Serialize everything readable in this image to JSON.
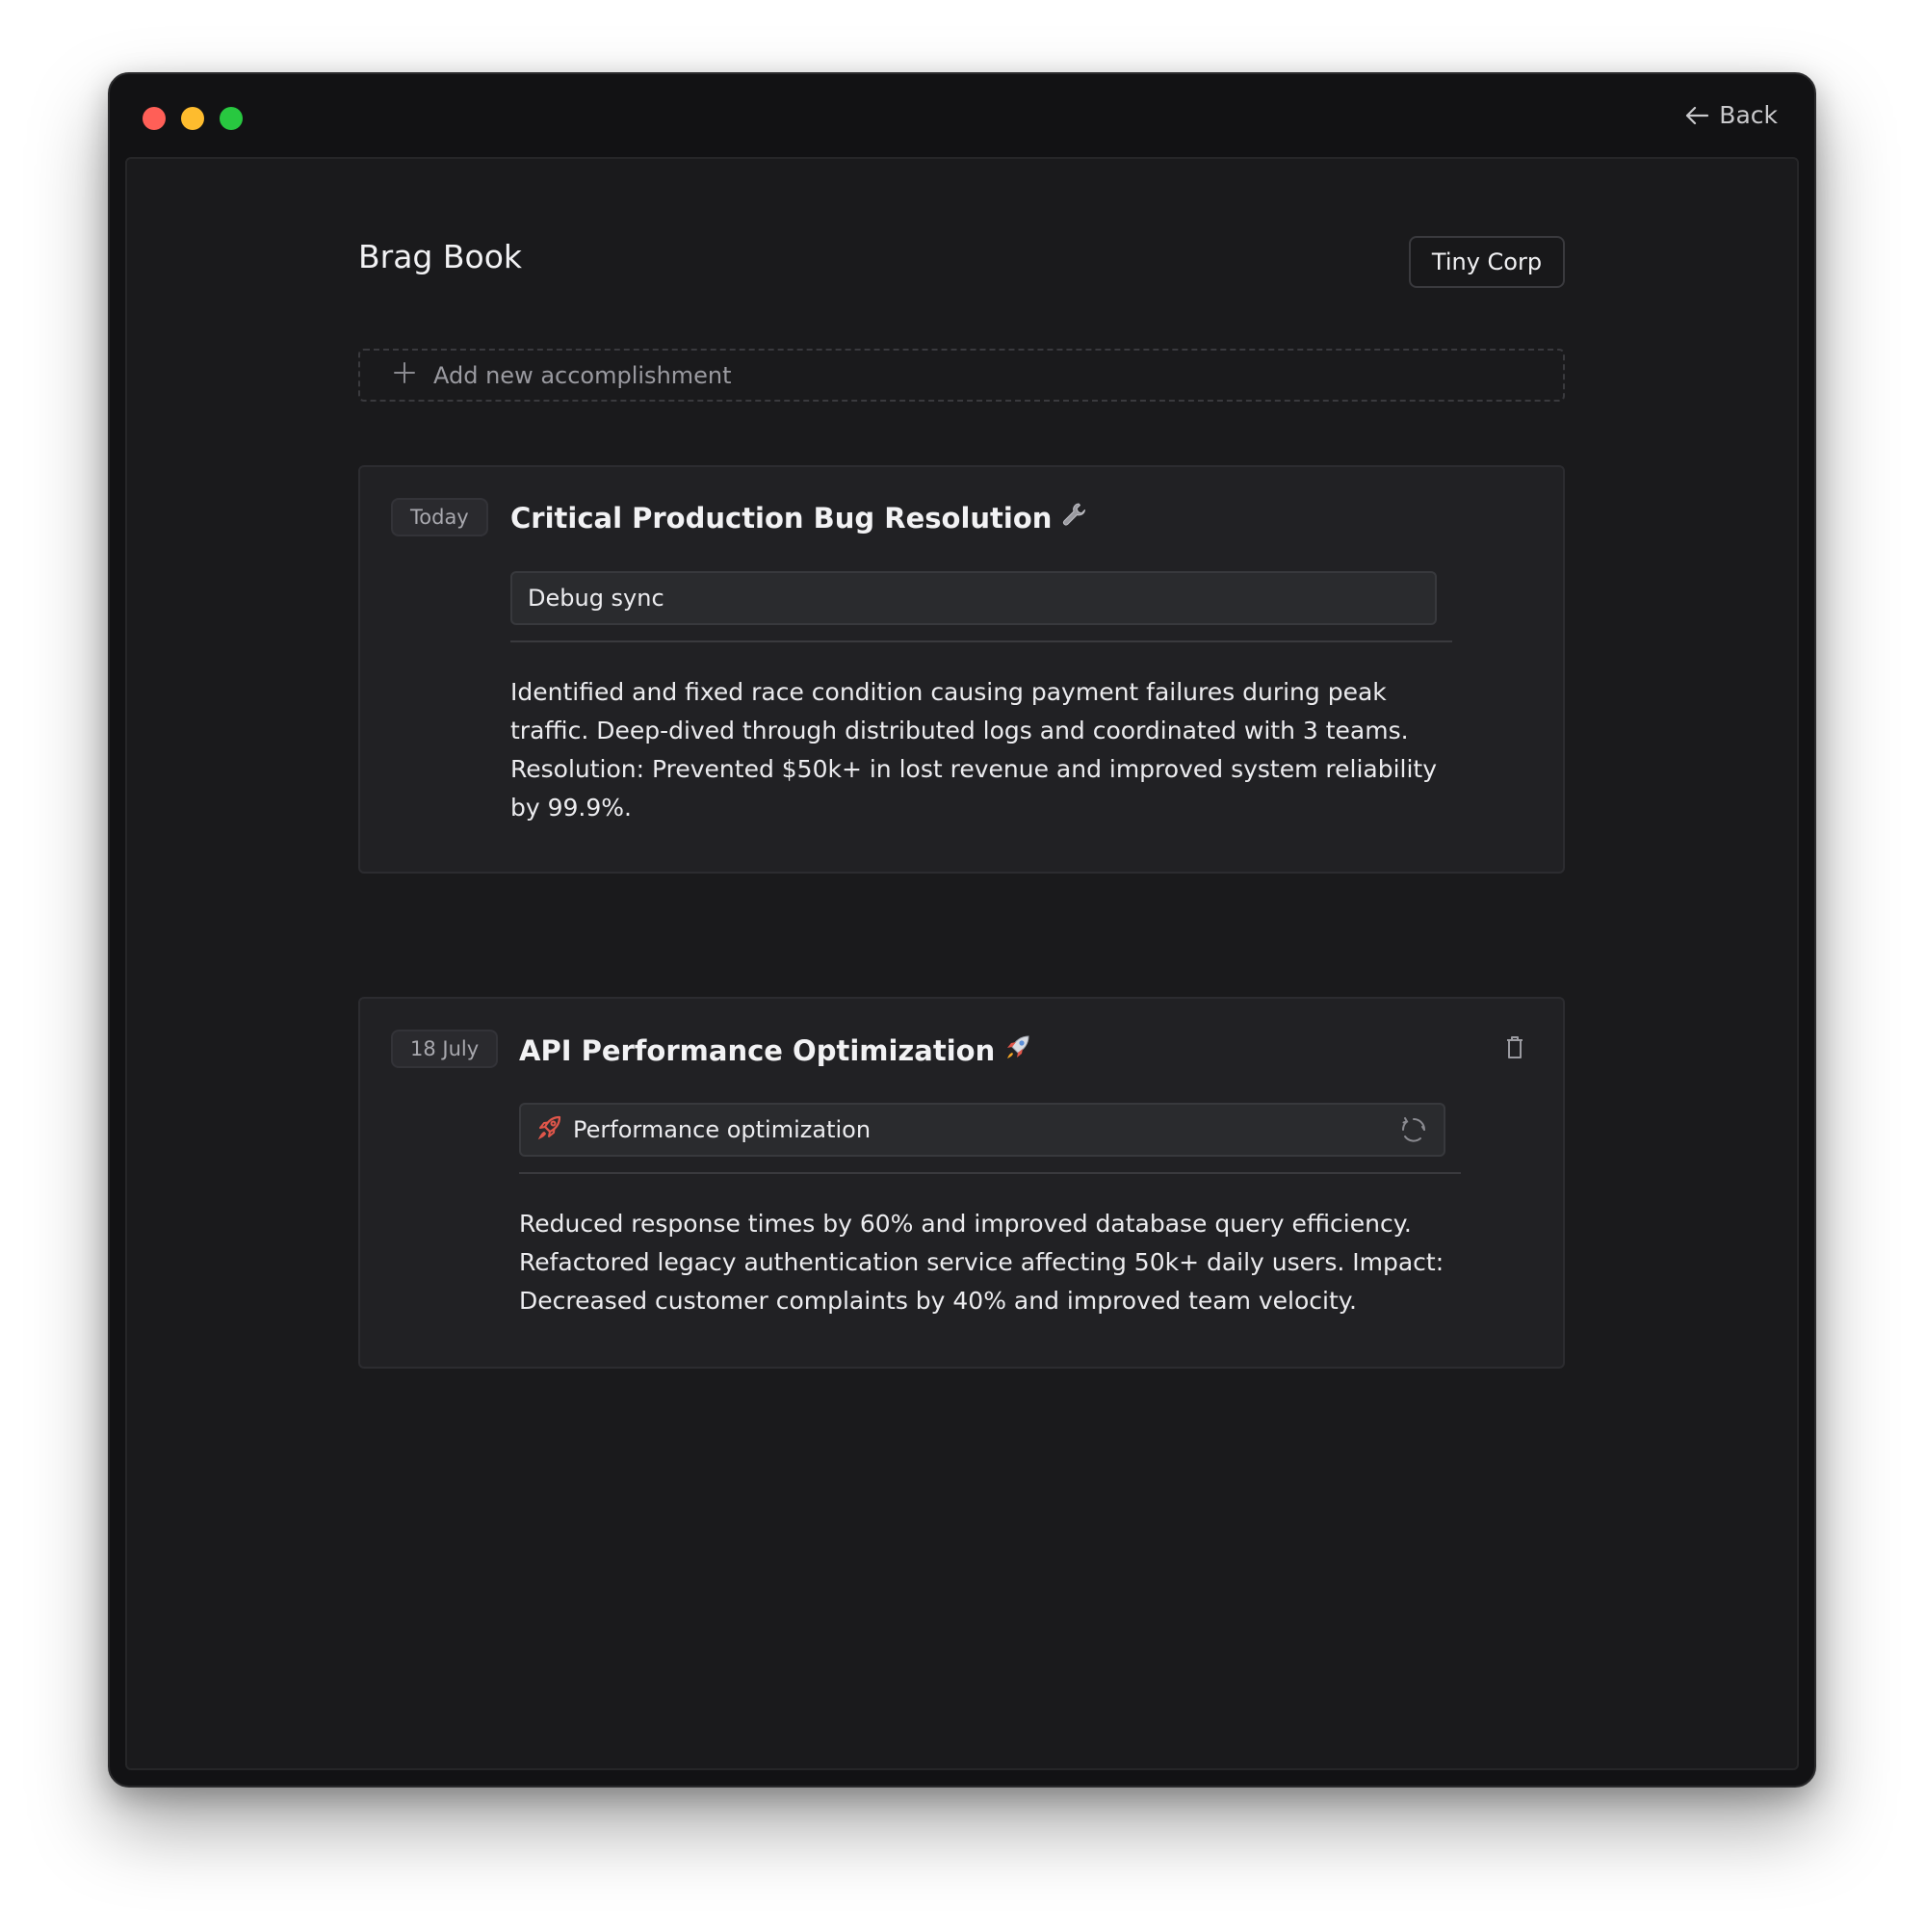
{
  "window": {
    "back_label": "Back"
  },
  "header": {
    "title": "Brag Book",
    "company": "Tiny Corp"
  },
  "add_new": {
    "label": "Add new accomplishment"
  },
  "entries": [
    {
      "date": "Today",
      "title": "Critical Production Bug Resolution",
      "title_icon": "wrench-icon",
      "tag": "Debug sync",
      "description": "Identified and fixed race condition causing payment failures during peak traffic. Deep-dived through distributed logs and coordinated with 3 teams. Resolution: Prevented $50k+ in lost revenue and improved system reliability by 99.9%."
    },
    {
      "date": "18 July",
      "title": "API Performance Optimization",
      "title_icon": "rocket-icon",
      "tag": "Performance optimization",
      "tag_icon": "rocket-icon",
      "description": "Reduced response times by 60% and improved database query efficiency. Refactored legacy authentication service affecting 50k+ daily users. Impact: Decreased customer complaints by 40% and improved team velocity."
    }
  ],
  "colors": {
    "window_bg": "#121214",
    "content_bg": "#1a1a1c",
    "card_bg": "#212124",
    "close": "#ff5f57",
    "minimize": "#febc2e",
    "maximize": "#28c840",
    "rocket": "#e0564a"
  }
}
